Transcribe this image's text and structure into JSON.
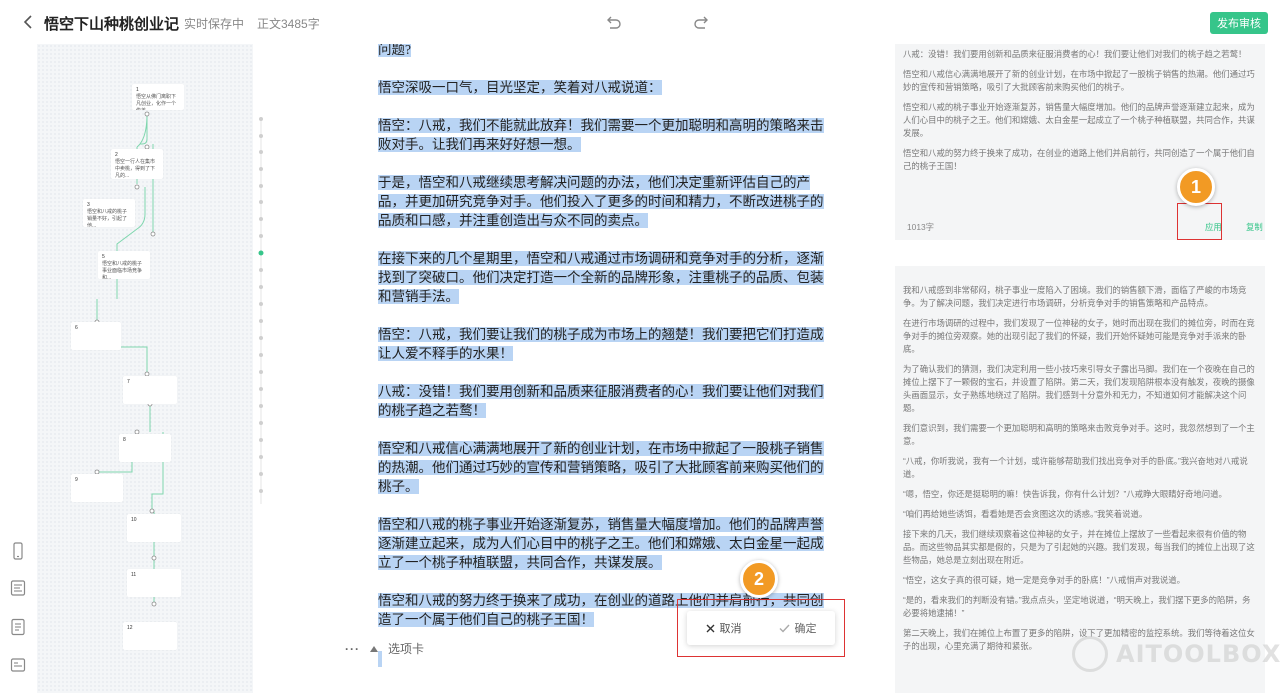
{
  "header": {
    "title": "悟空下山种桃创业记",
    "save_status": "实时保存中",
    "word_count": "正文3485字",
    "publish_label": "发布审核"
  },
  "outline": {
    "nodes": [
      {
        "num": "1",
        "text": "悟空从佛门离职下凡创业，化作一个俊美..."
      },
      {
        "num": "2",
        "text": "悟空一行人在集市中卖桃，得到了下凡的..."
      },
      {
        "num": "3",
        "text": "悟空和八戒的桃子销量不好，引起了他..."
      },
      {
        "num": "5",
        "text": "悟空和八戒的桃子事业面临市场竞争和..."
      },
      {
        "num": "6",
        "text": ""
      },
      {
        "num": "7",
        "text": ""
      },
      {
        "num": "8",
        "text": ""
      },
      {
        "num": "9",
        "text": ""
      },
      {
        "num": "10",
        "text": ""
      },
      {
        "num": "11",
        "text": ""
      },
      {
        "num": "12",
        "text": ""
      }
    ]
  },
  "editor": {
    "paragraphs": [
      "问题?",
      "悟空深吸一口气，目光坚定，笑着对八戒说道：",
      "悟空：八戒，我们不能就此放弃！我们需要一个更加聪明和高明的策略来击败对手。让我们再来好好想一想。",
      "于是，悟空和八戒继续思考解决问题的办法，他们决定重新评估自己的产品，并更加研究竞争对手。他们投入了更多的时间和精力，不断改进桃子的品质和口感，并注重创造出与众不同的卖点。",
      "在接下来的几个星期里，悟空和八戒通过市场调研和竞争对手的分析，逐渐找到了突破口。他们决定打造一个全新的品牌形象，注重桃子的品质、包装和营销手法。",
      "悟空：八戒，我们要让我们的桃子成为市场上的翘楚！我们要把它们打造成让人爱不释手的水果！",
      "八戒：没错！我们要用创新和品质来征服消费者的心！我们要让他们对我们的桃子趋之若鹜！",
      "悟空和八戒信心满满地展开了新的创业计划，在市场中掀起了一股桃子销售的热潮。他们通过巧妙的宣传和营销策略，吸引了大批顾客前来购买他们的桃子。",
      "悟空和八戒的桃子事业开始逐渐复苏，销售量大幅度增加。他们的品牌声誉逐渐建立起来，成为人们心目中的桃子之王。他们和嫦娥、太白金星一起成立了一个桃子种植联盟，共同合作，共谋发展。",
      "悟空和八戒的努力终于换来了成功，在创业的道路上他们并肩前行，共同创造了一个属于他们自己的桃子王国！"
    ],
    "tab_label": "选项卡",
    "more_label": "···",
    "cancel_label": "取消",
    "confirm_label": "确定"
  },
  "suggestions": {
    "card1": {
      "paragraphs": [
        "八戒：没错！我们要用创新和品质来征服消费者的心！我们要让他们对我们的桃子趋之若鹜！",
        "悟空和八戒信心满满地展开了新的创业计划，在市场中掀起了一股桃子销售的热潮。他们通过巧妙的宣传和营销策略，吸引了大批顾客前来购买他们的桃子。",
        "悟空和八戒的桃子事业开始逐渐复苏，销售量大幅度增加。他们的品牌声誉逐渐建立起来，成为人们心目中的桃子之王。他们和嫦娥、太白金星一起成立了一个桃子种植联盟，共同合作，共谋发展。",
        "悟空和八戒的努力终于换来了成功，在创业的道路上他们并肩前行，共同创造了一个属于他们自己的桃子王国！"
      ],
      "count": "1013字",
      "apply_label": "应用",
      "copy_label": "复制"
    },
    "card2": {
      "paragraphs": [
        "我和八戒感到非常郁闷，桃子事业一度陷入了困境。我们的销售额下滑，面临了严峻的市场竞争。为了解决问题，我们决定进行市场调研，分析竞争对手的销售策略和产品特点。",
        "在进行市场调研的过程中，我们发现了一位神秘的女子，她时而出现在我们的摊位旁，时而在竞争对手的摊位旁观察。她的出现引起了我们的怀疑，我们开始怀疑她可能是竞争对手派来的卧底。",
        "为了确认我们的猜测，我们决定利用一些小技巧来引导女子露出马脚。我们在一个夜晚在自己的摊位上摆下了一颗假的宝石，并设置了陷阱。第二天，我们发现陷阱根本没有触发，夜晚的摄像头画面显示，女子熟练地绕过了陷阱。我们感到十分意外和无力，不知道如何才能解决这个问题。",
        "我们意识到，我们需要一个更加聪明和高明的策略来击败竞争对手。这时，我忽然想到了一个主意。",
        "“八戒，你听我说，我有一个计划，或许能够帮助我们找出竞争对手的卧底。”我兴奋地对八戒说道。",
        "“嗯，悟空，你还是挺聪明的嘛！快告诉我，你有什么计划？”八戒睁大眼睛好奇地问道。",
        "“咱们再给她些诱饵，看看她是否会贪图这次的诱惑。”我笑着说道。",
        "接下来的几天，我们继续观察着这位神秘的女子，并在摊位上摆放了一些看起来很有价值的物品。而这些物品其实都是假的，只是为了引起她的兴趣。我们发现，每当我们的摊位上出现了这些物品，她总是立刻出现在附近。",
        "“悟空，这女子真的很可疑，她一定是竞争对手的卧底！”八戒悄声对我说道。",
        "“是的，看来我们的判断没有错。”我点点头，坚定地说道，“明天晚上，我们摆下更多的陷阱，务必要将她逮捕！”",
        "第二天晚上，我们在摊位上布置了更多的陷阱，设下了更加精密的监控系统。我们等待着这位女子的出现，心里充满了期待和紧张。"
      ]
    }
  },
  "annotations": {
    "badge1": "1",
    "badge2": "2"
  },
  "watermark": "AITOOLBOX",
  "colors": {
    "accent": "#36c58a",
    "selection": "#b9d4f4",
    "badge": "#f29a24",
    "highlight_box": "#dd3333"
  }
}
